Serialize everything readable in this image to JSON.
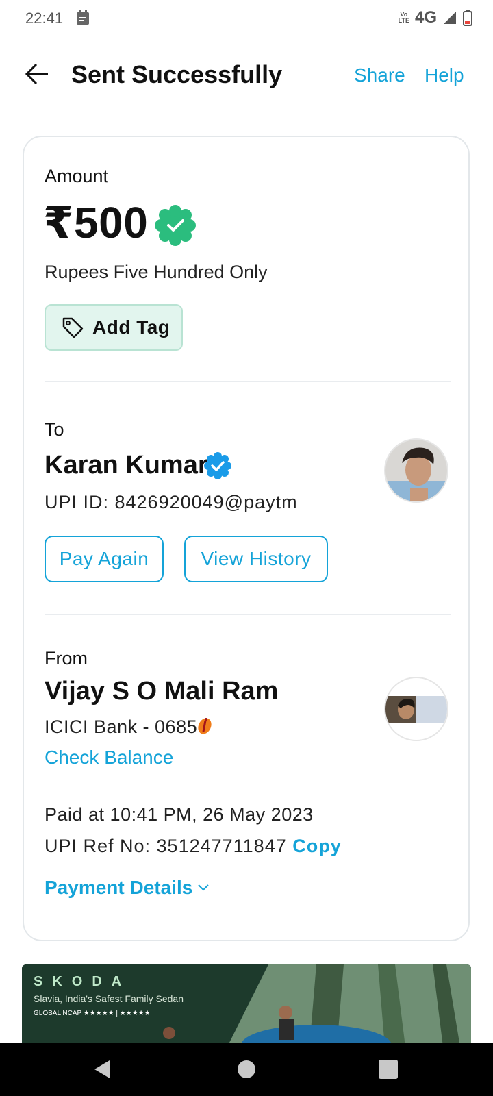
{
  "status_bar": {
    "time": "22:41",
    "volte_top": "Vo",
    "volte_bottom": "LTE",
    "network": "4G",
    "icons": [
      "calendar-icon",
      "signal-icon",
      "battery-icon"
    ]
  },
  "header": {
    "title": "Sent Successfully",
    "share": "Share",
    "help": "Help",
    "back_icon": "back-arrow-icon"
  },
  "amount": {
    "label": "Amount",
    "value": "₹500",
    "in_words": "Rupees Five Hundred Only",
    "add_tag": "Add Tag"
  },
  "recipient": {
    "label": "To",
    "name": "Karan Kumar",
    "upi_id": "UPI ID: 8426920049@paytm",
    "pay_again": "Pay Again",
    "view_history": "View History"
  },
  "sender": {
    "label": "From",
    "name": "Vijay S O Mali Ram",
    "bank": "ICICI Bank - 0685",
    "check_balance": "Check Balance"
  },
  "transaction": {
    "paid_at": "Paid at 10:41 PM, 26 May 2023",
    "ref_no": "UPI Ref No: 351247711847",
    "copy": "Copy",
    "payment_details": "Payment Details"
  },
  "ad": {
    "brand": "SKODA",
    "tagline": "Slavia, India's Safest Family Sedan",
    "ratings": "GLOBAL NCAP ★★★★★ | ★★★★★"
  },
  "colors": {
    "accent": "#14a3d8",
    "success": "#2bbd7e",
    "verified_blue": "#1a9be8",
    "tag_bg": "#e2f5ee"
  }
}
